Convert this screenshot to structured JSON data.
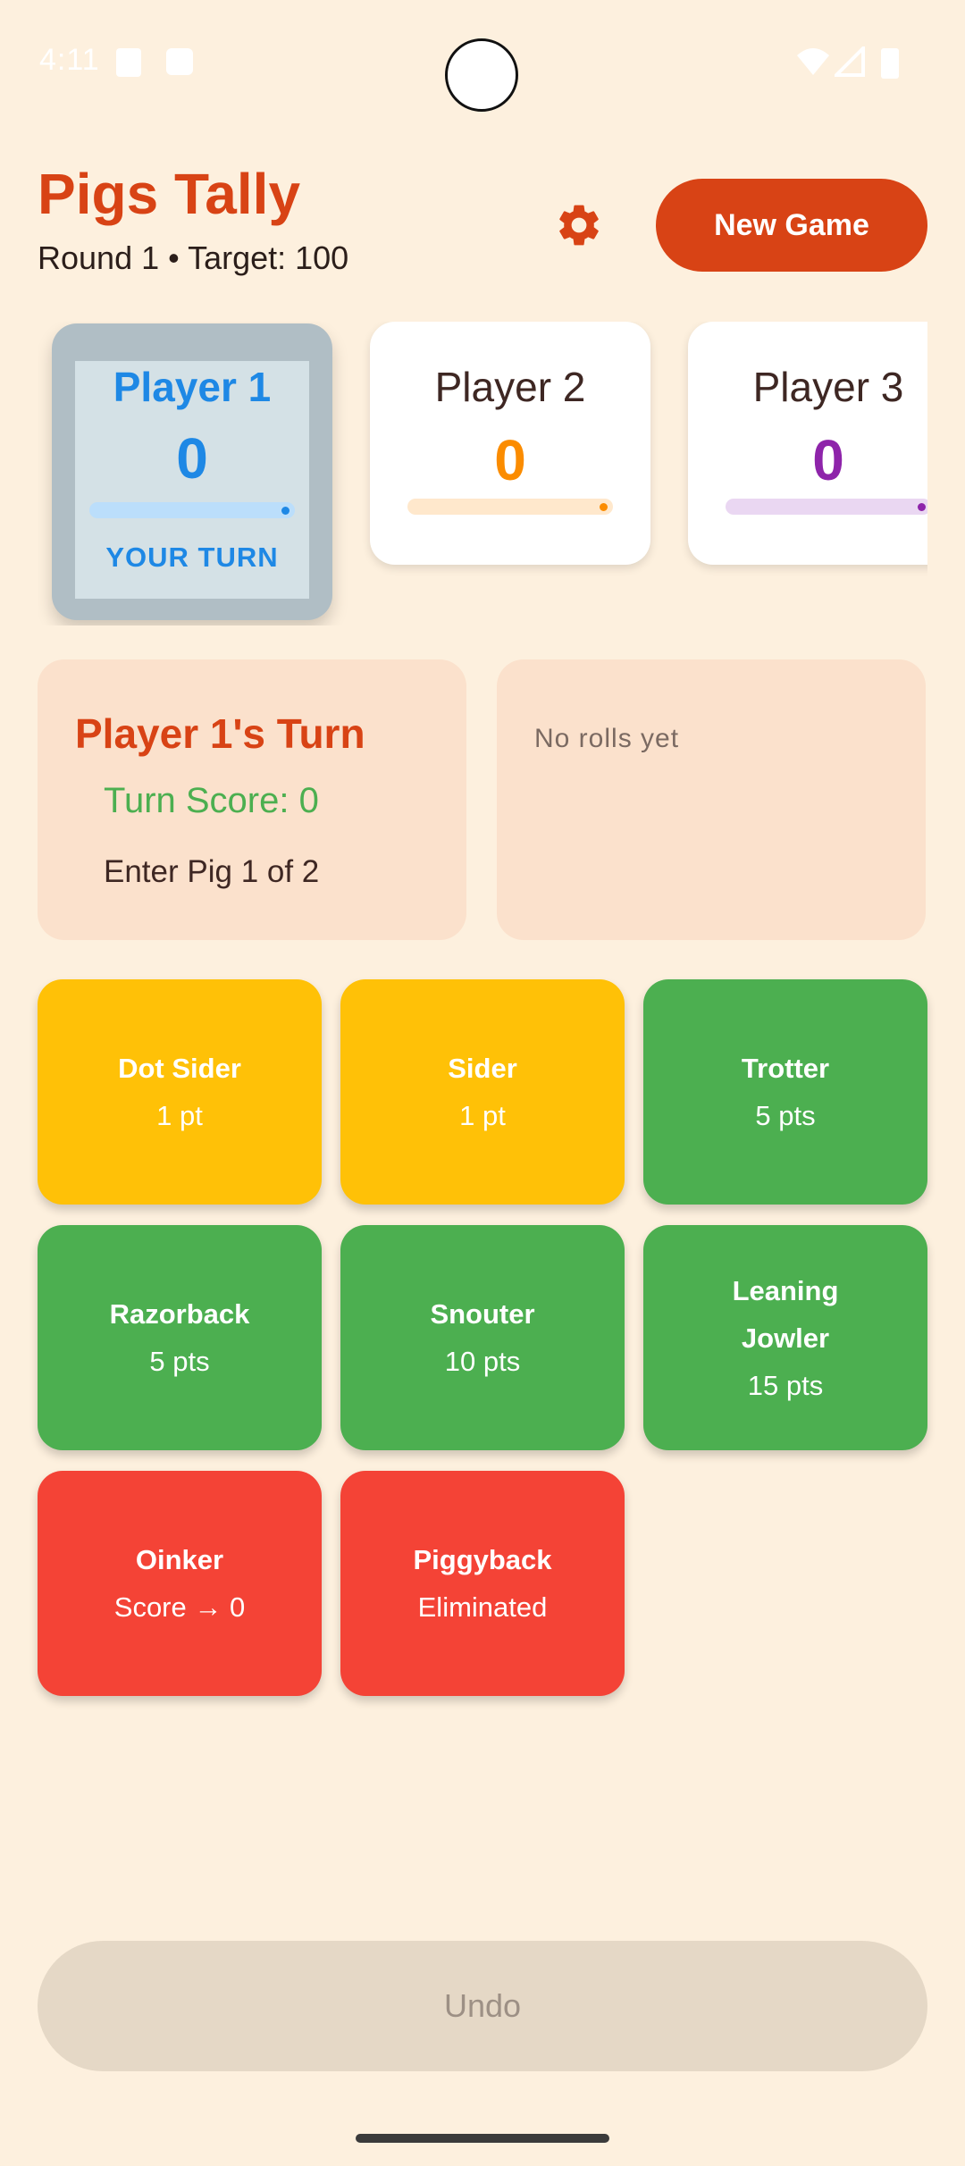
{
  "status": {
    "time": "4:11"
  },
  "header": {
    "title": "Pigs Tally",
    "subtitle": "Round 1 • Target: 100",
    "new_game": "New Game"
  },
  "players": [
    {
      "name": "Player 1",
      "score": "0",
      "turn_label": "YOUR TURN",
      "color": "#1E88E5",
      "bar": "#BBDEFB"
    },
    {
      "name": "Player 2",
      "score": "0",
      "color": "#FB8C00",
      "bar": "#FFE8CC"
    },
    {
      "name": "Player 3",
      "score": "0",
      "color": "#8E24AA",
      "bar": "#EAD7F2"
    }
  ],
  "turn": {
    "title": "Player 1's Turn",
    "score": "Turn Score: 0",
    "prompt": "Enter Pig 1 of 2"
  },
  "history": {
    "empty": "No rolls yet"
  },
  "rolls": [
    {
      "name": "Dot Sider",
      "points": "1 pt"
    },
    {
      "name": "Sider",
      "points": "1 pt"
    },
    {
      "name": "Trotter",
      "points": "5 pts"
    },
    {
      "name": "Razorback",
      "points": "5 pts"
    },
    {
      "name": "Snouter",
      "points": "10 pts"
    },
    {
      "name_line1": "Leaning",
      "name_line2": "Jowler",
      "points": "15 pts"
    },
    {
      "name": "Oinker",
      "points": "Score → 0"
    },
    {
      "name": "Piggyback",
      "points": "Eliminated"
    }
  ],
  "undo": "Undo",
  "colors": {
    "accent": "#D84315",
    "good": "#4CAF50",
    "warn": "#FFC107",
    "bad": "#F44336"
  }
}
